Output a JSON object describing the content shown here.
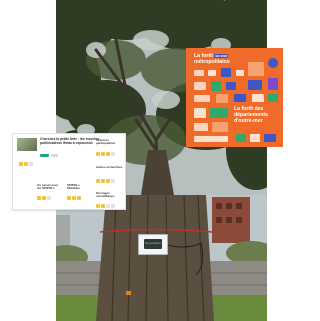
{
  "collage": {
    "photos": [
      {
        "subject": "tree-canopy"
      },
      {
        "subject": "tree-trunk-with-sensor"
      }
    ],
    "infographic": {
      "title_line1": "La forêt",
      "tag": "EN 2022",
      "title_line2": "métropolitaine",
      "title_line3": "La forêt des départements",
      "title_line4": "d'outre-mer",
      "colors": {
        "background": "#f06a2a",
        "accent_blue": "#3f57c4",
        "accent_green": "#2fa86c"
      }
    },
    "article": {
      "title": "Cherchez la petite bête : les insectes pollinisateurs ifmas à espoursivi",
      "sections": [
        {
          "label": "Sciences participatives",
          "rating": 3
        },
        {
          "label": "Autres recherches",
          "rating": 3
        },
        {
          "label": "Un savoir pour les SPIPOLs",
          "rating": 2
        },
        {
          "label": "SPIPOLs filmables",
          "rating": 3
        },
        {
          "label": "Ouvrages scientifiques",
          "rating": 2
        }
      ],
      "badge_color": "#24a37a"
    },
    "sensor": {
      "logo_text": "GreenMeter"
    }
  }
}
